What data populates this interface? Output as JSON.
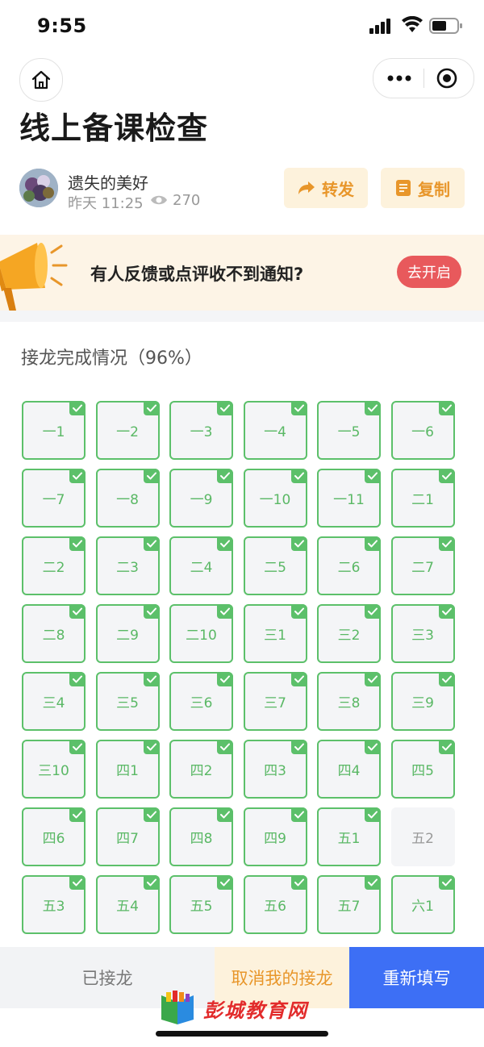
{
  "status_bar": {
    "time": "9:55"
  },
  "page": {
    "title": "线上备课检查"
  },
  "author": {
    "name": "遗失的美好",
    "time": "昨天 11:25",
    "views": "270"
  },
  "actions": {
    "share_label": "转发",
    "copy_label": "复制"
  },
  "banner": {
    "text": "有人反馈或点评收不到通知?",
    "button": "去开启"
  },
  "progress": {
    "label": "接龙完成情况（96%）",
    "percent": 96
  },
  "grid": [
    {
      "label": "一1",
      "done": true
    },
    {
      "label": "一2",
      "done": true
    },
    {
      "label": "一3",
      "done": true
    },
    {
      "label": "一4",
      "done": true
    },
    {
      "label": "一5",
      "done": true
    },
    {
      "label": "一6",
      "done": true
    },
    {
      "label": "一7",
      "done": true
    },
    {
      "label": "一8",
      "done": true
    },
    {
      "label": "一9",
      "done": true
    },
    {
      "label": "一10",
      "done": true
    },
    {
      "label": "一11",
      "done": true
    },
    {
      "label": "二1",
      "done": true
    },
    {
      "label": "二2",
      "done": true
    },
    {
      "label": "二3",
      "done": true
    },
    {
      "label": "二4",
      "done": true
    },
    {
      "label": "二5",
      "done": true
    },
    {
      "label": "二6",
      "done": true
    },
    {
      "label": "二7",
      "done": true
    },
    {
      "label": "二8",
      "done": true
    },
    {
      "label": "二9",
      "done": true
    },
    {
      "label": "二10",
      "done": true
    },
    {
      "label": "三1",
      "done": true
    },
    {
      "label": "三2",
      "done": true
    },
    {
      "label": "三3",
      "done": true
    },
    {
      "label": "三4",
      "done": true
    },
    {
      "label": "三5",
      "done": true
    },
    {
      "label": "三6",
      "done": true
    },
    {
      "label": "三7",
      "done": true
    },
    {
      "label": "三8",
      "done": true
    },
    {
      "label": "三9",
      "done": true
    },
    {
      "label": "三10",
      "done": true
    },
    {
      "label": "四1",
      "done": true
    },
    {
      "label": "四2",
      "done": true
    },
    {
      "label": "四3",
      "done": true
    },
    {
      "label": "四4",
      "done": true
    },
    {
      "label": "四5",
      "done": true
    },
    {
      "label": "四6",
      "done": true
    },
    {
      "label": "四7",
      "done": true
    },
    {
      "label": "四8",
      "done": true
    },
    {
      "label": "四9",
      "done": true
    },
    {
      "label": "五1",
      "done": true
    },
    {
      "label": "五2",
      "done": false
    },
    {
      "label": "五3",
      "done": true
    },
    {
      "label": "五4",
      "done": true
    },
    {
      "label": "五5",
      "done": true
    },
    {
      "label": "五6",
      "done": true
    },
    {
      "label": "五7",
      "done": true
    },
    {
      "label": "六1",
      "done": true
    }
  ],
  "bottom_bar": {
    "joined": "已接龙",
    "cancel": "取消我的接龙",
    "refill": "重新填写"
  },
  "watermark": {
    "text": "彭城教育网"
  },
  "colors": {
    "green": "#5cc06a",
    "orange": "#e8962a",
    "blue": "#3d6ff5",
    "red": "#e8595c"
  }
}
